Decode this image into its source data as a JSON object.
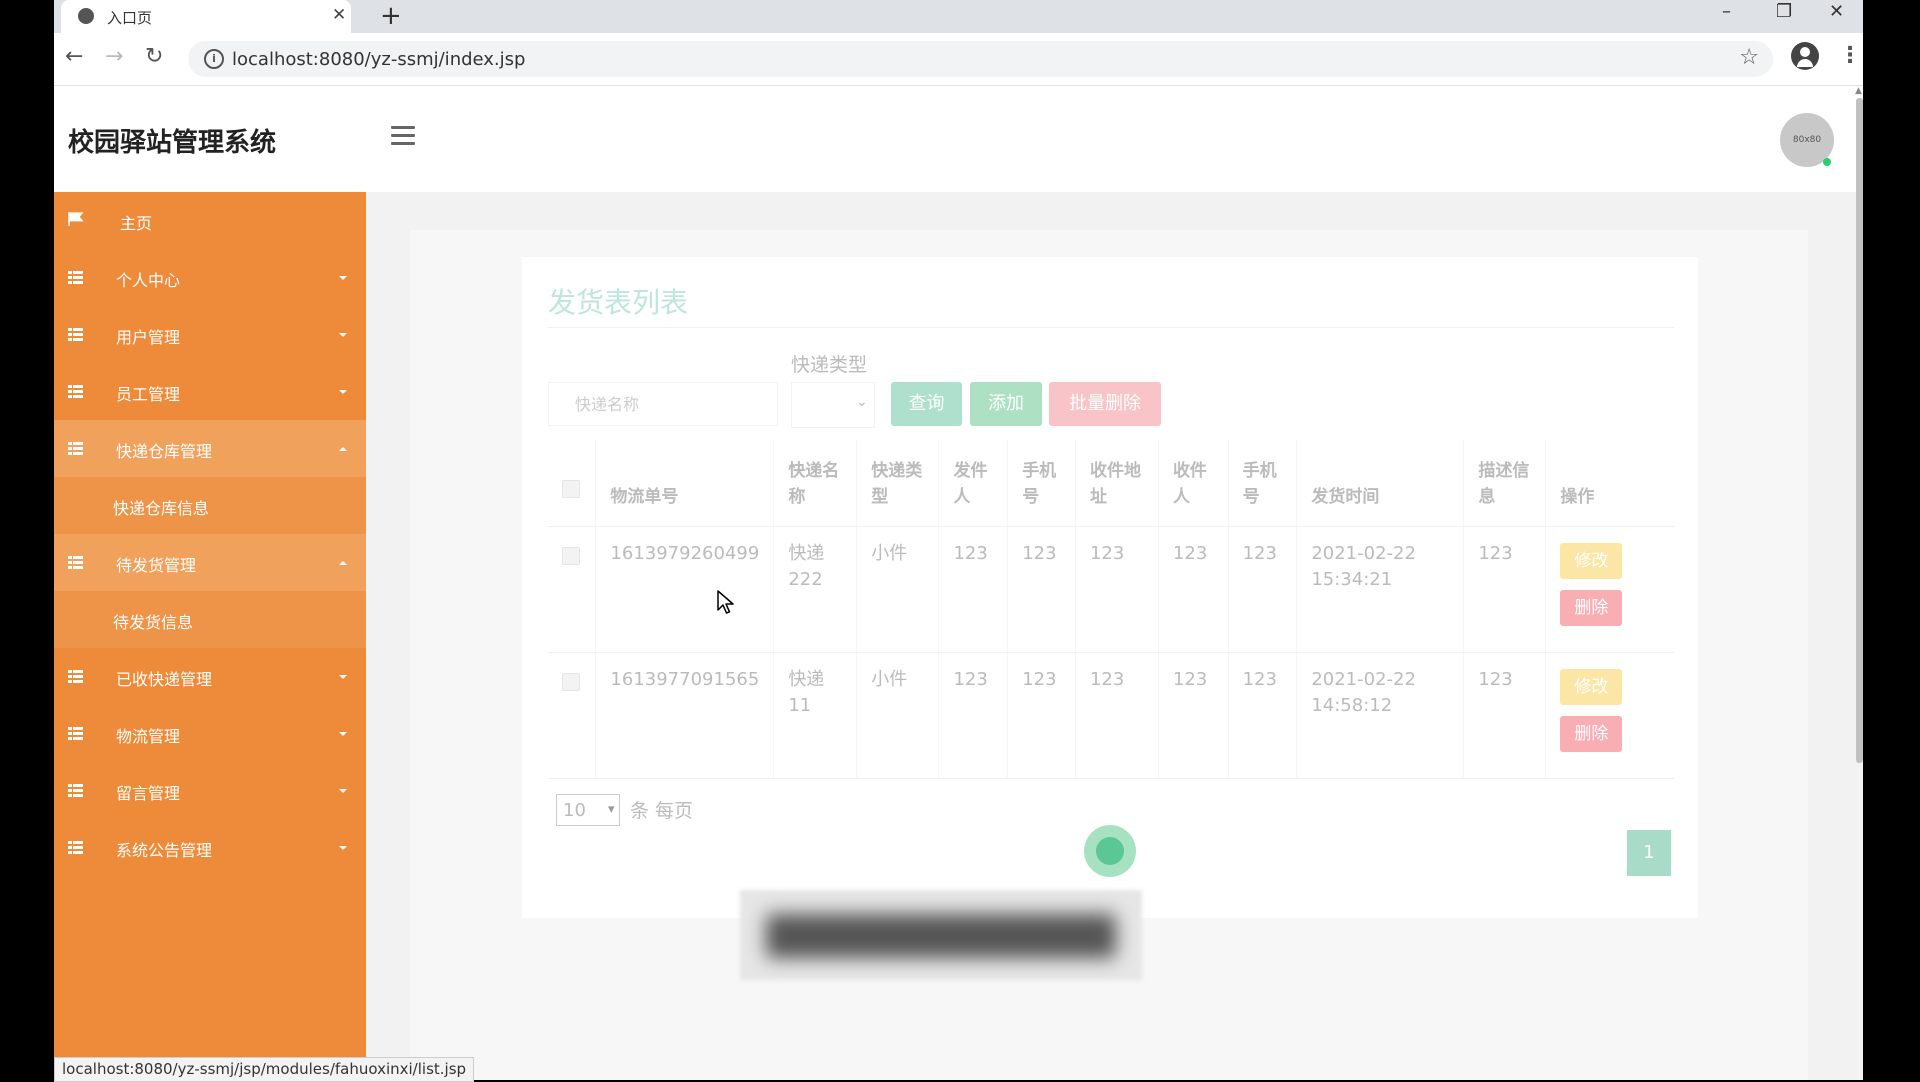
{
  "browser": {
    "tab_title": "入口页",
    "url": "localhost:8080/yz-ssmj/index.jsp",
    "status_url": "localhost:8080/yz-ssmj/jsp/modules/fahuoxinxi/list.jsp"
  },
  "header": {
    "app_title": "校园驿站管理系统",
    "avatar_text": "80x80"
  },
  "sidebar": {
    "items": [
      {
        "label": "主页"
      },
      {
        "label": "个人中心"
      },
      {
        "label": "用户管理"
      },
      {
        "label": "员工管理"
      },
      {
        "label": "快递仓库管理"
      },
      {
        "label": "快递仓库信息"
      },
      {
        "label": "待发货管理"
      },
      {
        "label": "待发货信息"
      },
      {
        "label": "已收快递管理"
      },
      {
        "label": "物流管理"
      },
      {
        "label": "留言管理"
      },
      {
        "label": "系统公告管理"
      }
    ]
  },
  "panel": {
    "title": "发货表列表",
    "filter_label": "快递类型",
    "search_placeholder": "快递名称",
    "query_label": "查询",
    "add_label": "添加",
    "batch_delete_label": "批量删除"
  },
  "table": {
    "headers": [
      "物流单号",
      "快递名称",
      "快递类型",
      "发件人",
      "手机号",
      "收件地址",
      "收件人",
      "手机号",
      "发货时间",
      "描述信息",
      "操作"
    ],
    "rows": [
      {
        "tracking": "1613979260499",
        "name": "快递222",
        "type": "小件",
        "sender": "123",
        "sender_phone": "123",
        "address": "123",
        "receiver": "123",
        "receiver_phone": "123",
        "time": "2021-02-22 15:34:21",
        "desc": "123"
      },
      {
        "tracking": "1613977091565",
        "name": "快递11",
        "type": "小件",
        "sender": "123",
        "sender_phone": "123",
        "address": "123",
        "receiver": "123",
        "receiver_phone": "123",
        "time": "2021-02-22 14:58:12",
        "desc": "123"
      }
    ],
    "edit_label": "修改",
    "delete_label": "删除"
  },
  "pager": {
    "page_size": "10",
    "per_page_label": "条 每页",
    "current_page": "1"
  },
  "colors": {
    "sidebar": "#ed8b3a",
    "accent_green": "#aee0cd",
    "danger_pink": "#f9c4c7"
  }
}
